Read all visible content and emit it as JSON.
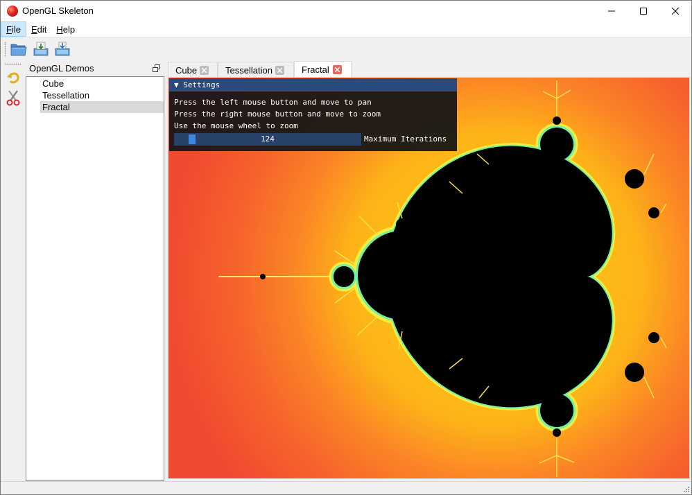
{
  "window": {
    "title": "OpenGL Skeleton",
    "icon": "red-sphere-icon"
  },
  "menubar": {
    "items": [
      {
        "label": "File",
        "mnemonic": "F",
        "rest": "ile"
      },
      {
        "label": "Edit",
        "mnemonic": "E",
        "rest": "dit"
      },
      {
        "label": "Help",
        "mnemonic": "H",
        "rest": "elp"
      }
    ]
  },
  "toolbar": {
    "buttons": [
      "open-folder-icon",
      "save-icon",
      "save-as-icon"
    ]
  },
  "side_toolbar": {
    "buttons": [
      "undo-icon",
      "cut-icon"
    ]
  },
  "dock": {
    "title": "OpenGL Demos",
    "items": [
      "Cube",
      "Tessellation",
      "Fractal"
    ],
    "selected": "Fractal"
  },
  "tabs": {
    "items": [
      "Cube",
      "Tessellation",
      "Fractal"
    ],
    "active": "Fractal"
  },
  "settings": {
    "title": "Settings",
    "lines": [
      "Press the left mouse button and move to pan",
      "Press the right mouse button and move to zoom",
      "Use the mouse wheel to zoom"
    ],
    "slider_value": "124",
    "slider_label": "Maximum Iterations"
  },
  "colors": {
    "fractal_outer": "#f14a30",
    "fractal_mid": "#fb7a26",
    "fractal_inner": "#fdb318",
    "fractal_edge": "#f2f542",
    "fractal_fringe": "#6df0a8",
    "fractal_set": "#000000",
    "imgui_title": "#294a7a",
    "slider_grab": "#3d85e0"
  }
}
